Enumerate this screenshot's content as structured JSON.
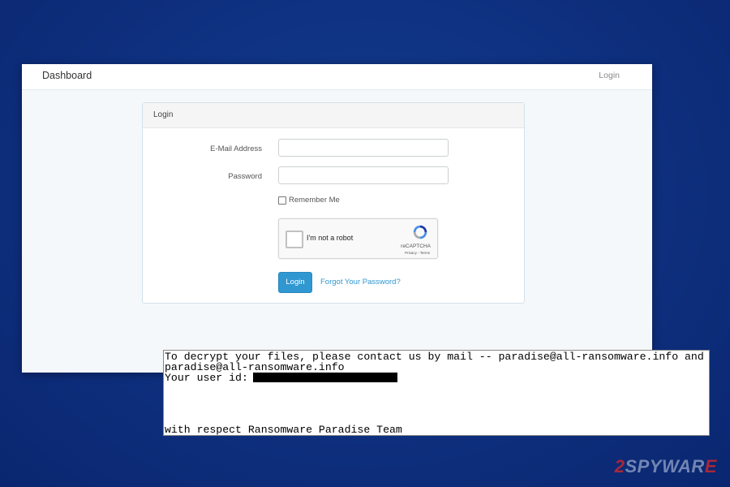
{
  "app": {
    "brand": "Dashboard",
    "nav_login": "Login"
  },
  "login_panel": {
    "heading": "Login",
    "email_label": "E-Mail Address",
    "email_value": "",
    "password_label": "Password",
    "password_value": "",
    "remember_label": "Remember Me",
    "recaptcha": {
      "label": "I'm not a robot",
      "brand": "reCAPTCHA",
      "links": "Privacy - Terms"
    },
    "login_button": "Login",
    "forgot_link": "Forgot Your Password?"
  },
  "ransom_note": {
    "line1": "To decrypt your files, please contact us by mail -- paradise@all-ransomware.info and",
    "line2": "paradise@all-ransomware.info",
    "user_id_label": "Your user id:",
    "signature": "with respect Ransomware Paradise Team"
  },
  "watermark": {
    "digit": "2",
    "text": "SPYWAR",
    "end": "E"
  },
  "colors": {
    "background": "#0f3282",
    "accent": "#3097d1"
  }
}
